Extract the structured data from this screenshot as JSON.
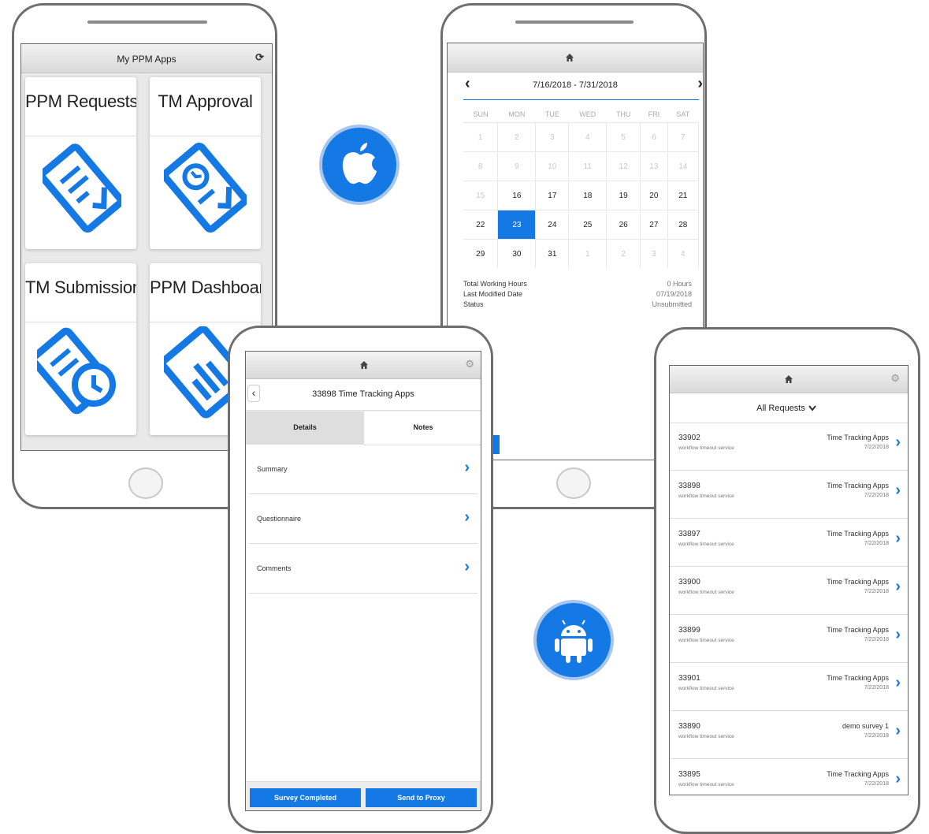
{
  "phone1": {
    "title": "My PPM Apps",
    "refresh_icon": "refresh-icon",
    "tiles": [
      {
        "label": "PPM Requests",
        "icon": "requests-icon"
      },
      {
        "label": "TM Approval",
        "icon": "approval-icon"
      },
      {
        "label": "TM Submission",
        "icon": "submission-icon"
      },
      {
        "label": "PPM Dashboard",
        "icon": "dashboard-icon"
      }
    ]
  },
  "phone2": {
    "home_icon": "home-icon",
    "date_range": "7/16/2018 - 7/31/2018",
    "weekdays": [
      "SUN",
      "MON",
      "TUE",
      "WED",
      "THU",
      "FRI",
      "SAT"
    ],
    "weeks": [
      [
        "1",
        "2",
        "3",
        "4",
        "5",
        "6",
        "7"
      ],
      [
        "8",
        "9",
        "10",
        "11",
        "12",
        "13",
        "14"
      ],
      [
        "15",
        "16",
        "17",
        "18",
        "19",
        "20",
        "21"
      ],
      [
        "22",
        "23",
        "24",
        "25",
        "26",
        "27",
        "28"
      ],
      [
        "29",
        "30",
        "31",
        "1",
        "2",
        "3",
        "4"
      ]
    ],
    "selected_day": "23",
    "info": [
      {
        "label": "Total Working Hours",
        "value": "0 Hours"
      },
      {
        "label": "Last Modified Date",
        "value": "07/19/2018"
      },
      {
        "label": "Status",
        "value": "Unsubmitted"
      }
    ]
  },
  "phone3": {
    "title": "33898 Time Tracking Apps",
    "tabs": [
      "Details",
      "Notes"
    ],
    "items": [
      "Summary",
      "Questionnaire",
      "Comments"
    ],
    "buttons": [
      "Survey Completed",
      "Send to Proxy"
    ]
  },
  "phone4": {
    "filter": "All Requests",
    "requests": [
      {
        "id": "33902",
        "sub": "workflow timeout service",
        "name": "Time Tracking Apps",
        "date": "7/22/2018"
      },
      {
        "id": "33898",
        "sub": "workflow timeout service",
        "name": "Time Tracking Apps",
        "date": "7/22/2018"
      },
      {
        "id": "33897",
        "sub": "workflow timeout service",
        "name": "Time Tracking Apps",
        "date": "7/22/2018"
      },
      {
        "id": "33900",
        "sub": "workflow timeout service",
        "name": "Time Tracking Apps",
        "date": "7/22/2018"
      },
      {
        "id": "33899",
        "sub": "workflow timeout service",
        "name": "Time Tracking Apps",
        "date": "7/22/2018"
      },
      {
        "id": "33901",
        "sub": "workflow timeout service",
        "name": "Time Tracking Apps",
        "date": "7/22/2018"
      },
      {
        "id": "33890",
        "sub": "workflow timeout service",
        "name": "demo survey 1",
        "date": "7/22/2018"
      },
      {
        "id": "33895",
        "sub": "workflow timeout service",
        "name": "Time Tracking Apps",
        "date": "7/22/2018"
      }
    ]
  },
  "badges": {
    "ios": "apple-logo-icon",
    "android": "android-logo-icon"
  },
  "colors": {
    "accent": "#1479e5",
    "frame": "#6e6e6e"
  }
}
